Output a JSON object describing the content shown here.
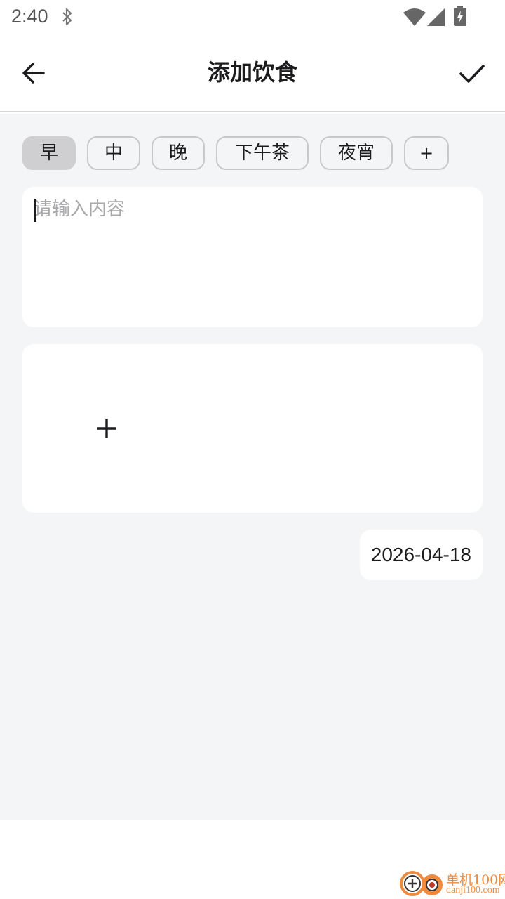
{
  "status_bar": {
    "time": "2:40",
    "icons": [
      "bluetooth-icon",
      "wifi-icon",
      "signal-icon",
      "battery-charging-icon"
    ]
  },
  "app_bar": {
    "title": "添加饮食",
    "back_icon": "arrow-left-icon",
    "confirm_icon": "check-icon"
  },
  "meal_chips": [
    {
      "label": "早",
      "selected": true
    },
    {
      "label": "中",
      "selected": false
    },
    {
      "label": "晚",
      "selected": false
    },
    {
      "label": "下午茶",
      "selected": false
    },
    {
      "label": "夜宵",
      "selected": false
    },
    {
      "label": "+",
      "selected": false
    }
  ],
  "content_input": {
    "placeholder": "请输入内容",
    "value": ""
  },
  "photo_box": {
    "add_icon": "plus-icon"
  },
  "date": "2026-04-18",
  "watermark": {
    "name": "单机100网",
    "url": "danji100.com"
  },
  "colors": {
    "background": "#f4f5f7",
    "card": "#ffffff",
    "chip_selected": "#cfcfd1",
    "chip_border": "#c9c9cc",
    "watermark": "#f08a3c"
  }
}
